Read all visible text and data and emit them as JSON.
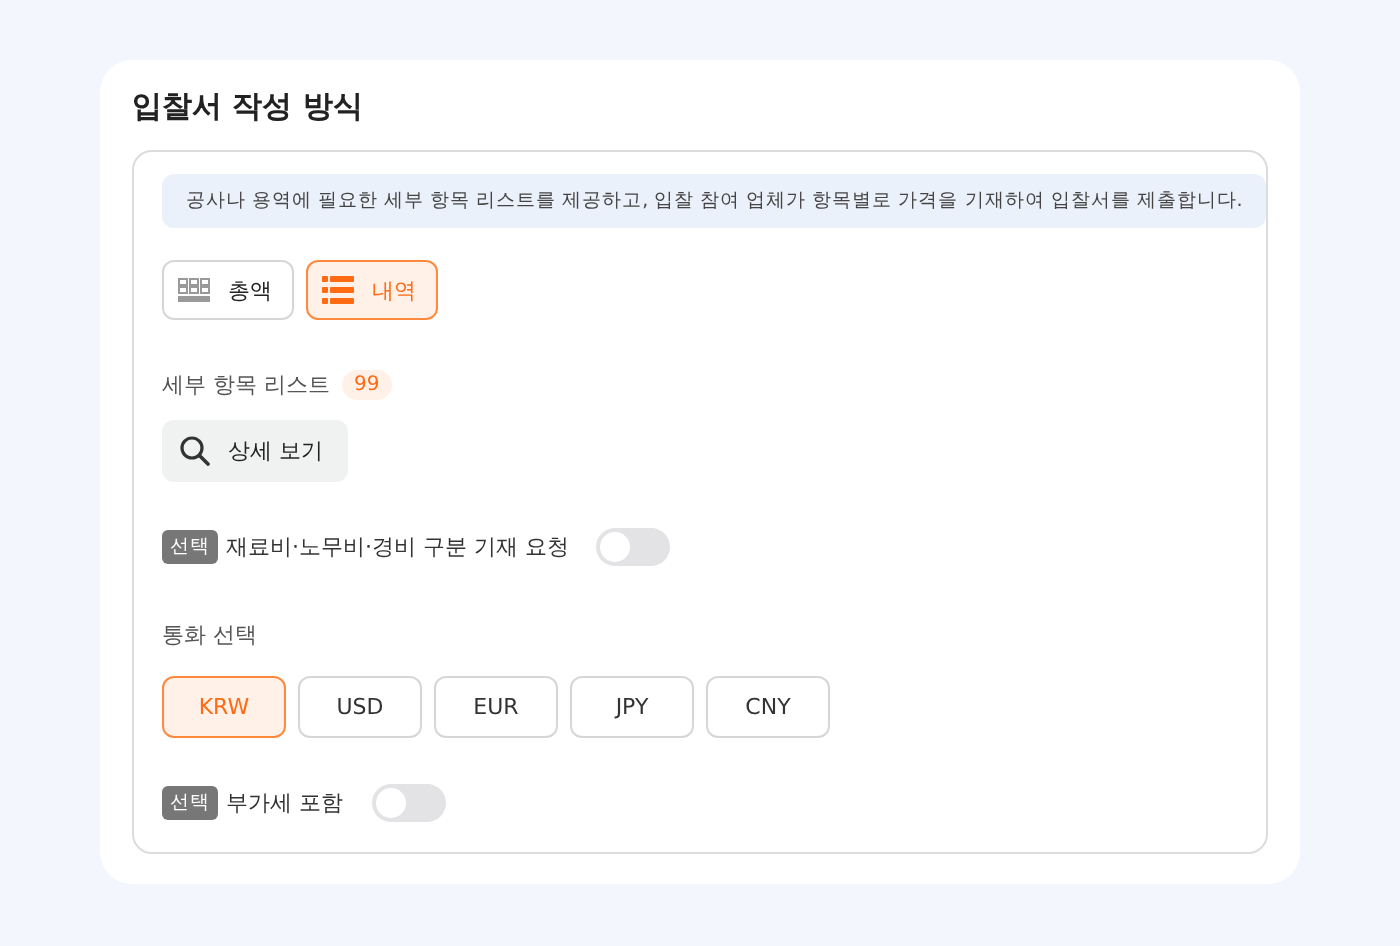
{
  "title": "입찰서 작성 방식",
  "info": "공사나 용역에 필요한 세부 항목 리스트를 제공하고, 입찰 참여 업체가 항목별로 가격을 기재하여 입찰서를 제출합니다.",
  "modes": [
    {
      "label": "총액",
      "kind": "grid",
      "selected": false
    },
    {
      "label": "내역",
      "kind": "list",
      "selected": true
    }
  ],
  "item_list": {
    "label": "세부 항목 리스트",
    "count": "99",
    "button": "상세 보기"
  },
  "cost_split": {
    "badge": "선택",
    "label": "재료비·노무비·경비 구분 기재 요청",
    "on": false
  },
  "currency": {
    "label": "통화 선택",
    "options": [
      {
        "label": "KRW",
        "selected": true
      },
      {
        "label": "USD",
        "selected": false
      },
      {
        "label": "EUR",
        "selected": false
      },
      {
        "label": "JPY",
        "selected": false
      },
      {
        "label": "CNY",
        "selected": false
      }
    ]
  },
  "vat": {
    "badge": "선택",
    "label": "부가세 포함",
    "on": false
  }
}
